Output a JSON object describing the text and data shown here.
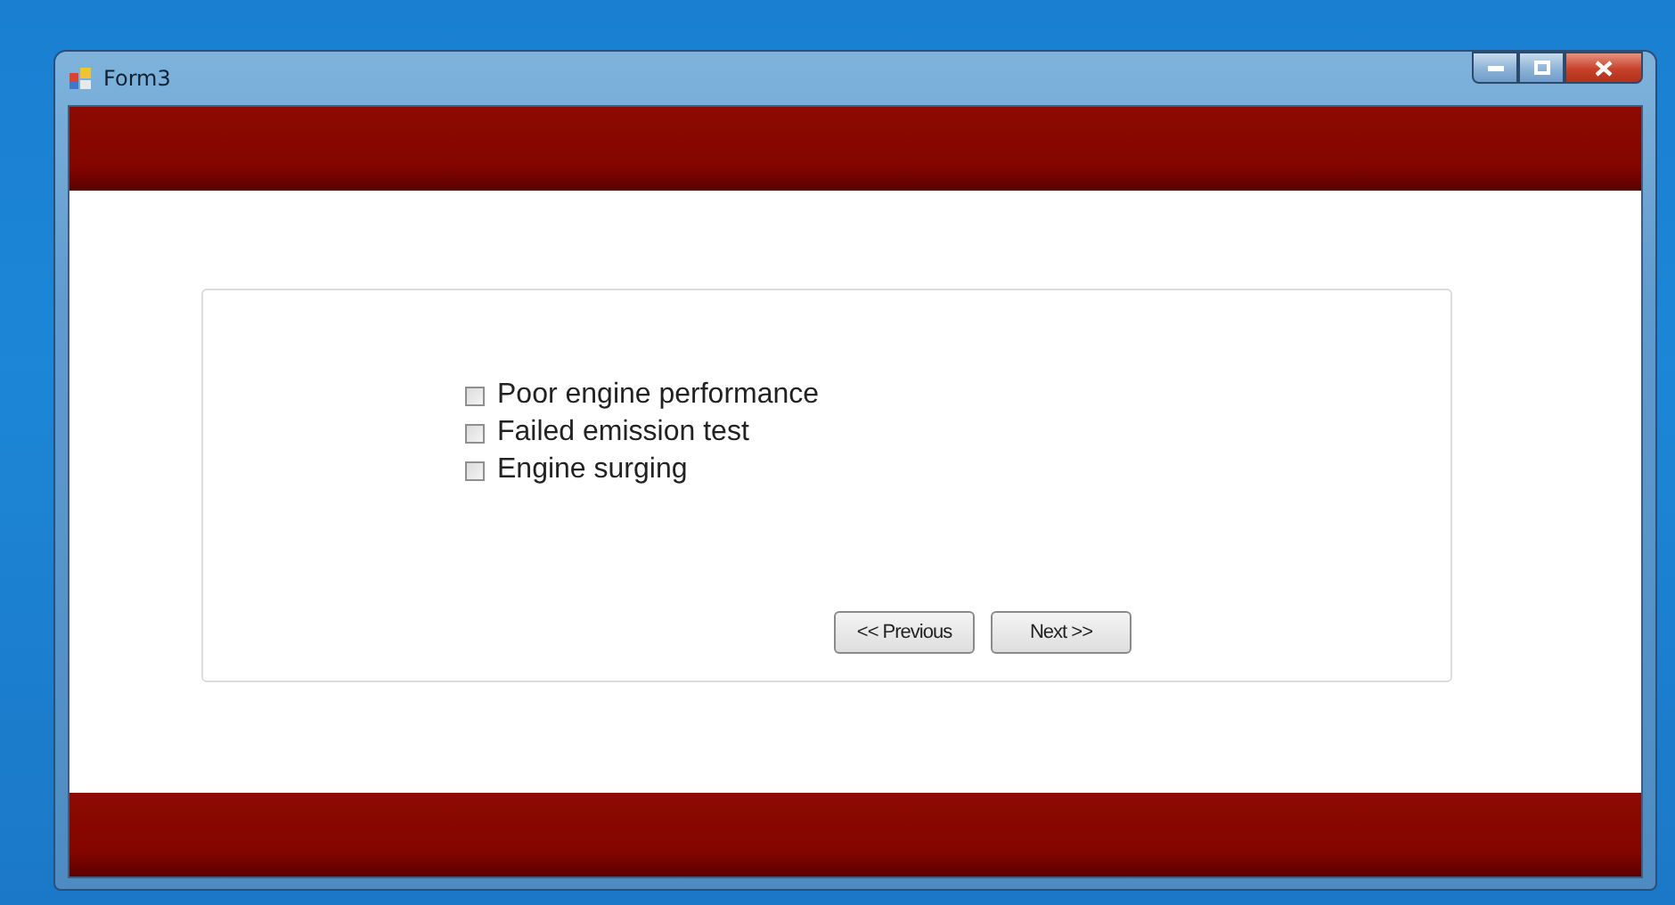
{
  "window": {
    "title": "Form3"
  },
  "options": [
    {
      "label": "Poor engine performance",
      "checked": false
    },
    {
      "label": "Failed emission test",
      "checked": false
    },
    {
      "label": "Engine surging",
      "checked": false
    }
  ],
  "buttons": [
    {
      "label": "<< Previous"
    },
    {
      "label": "Next >>"
    }
  ]
}
